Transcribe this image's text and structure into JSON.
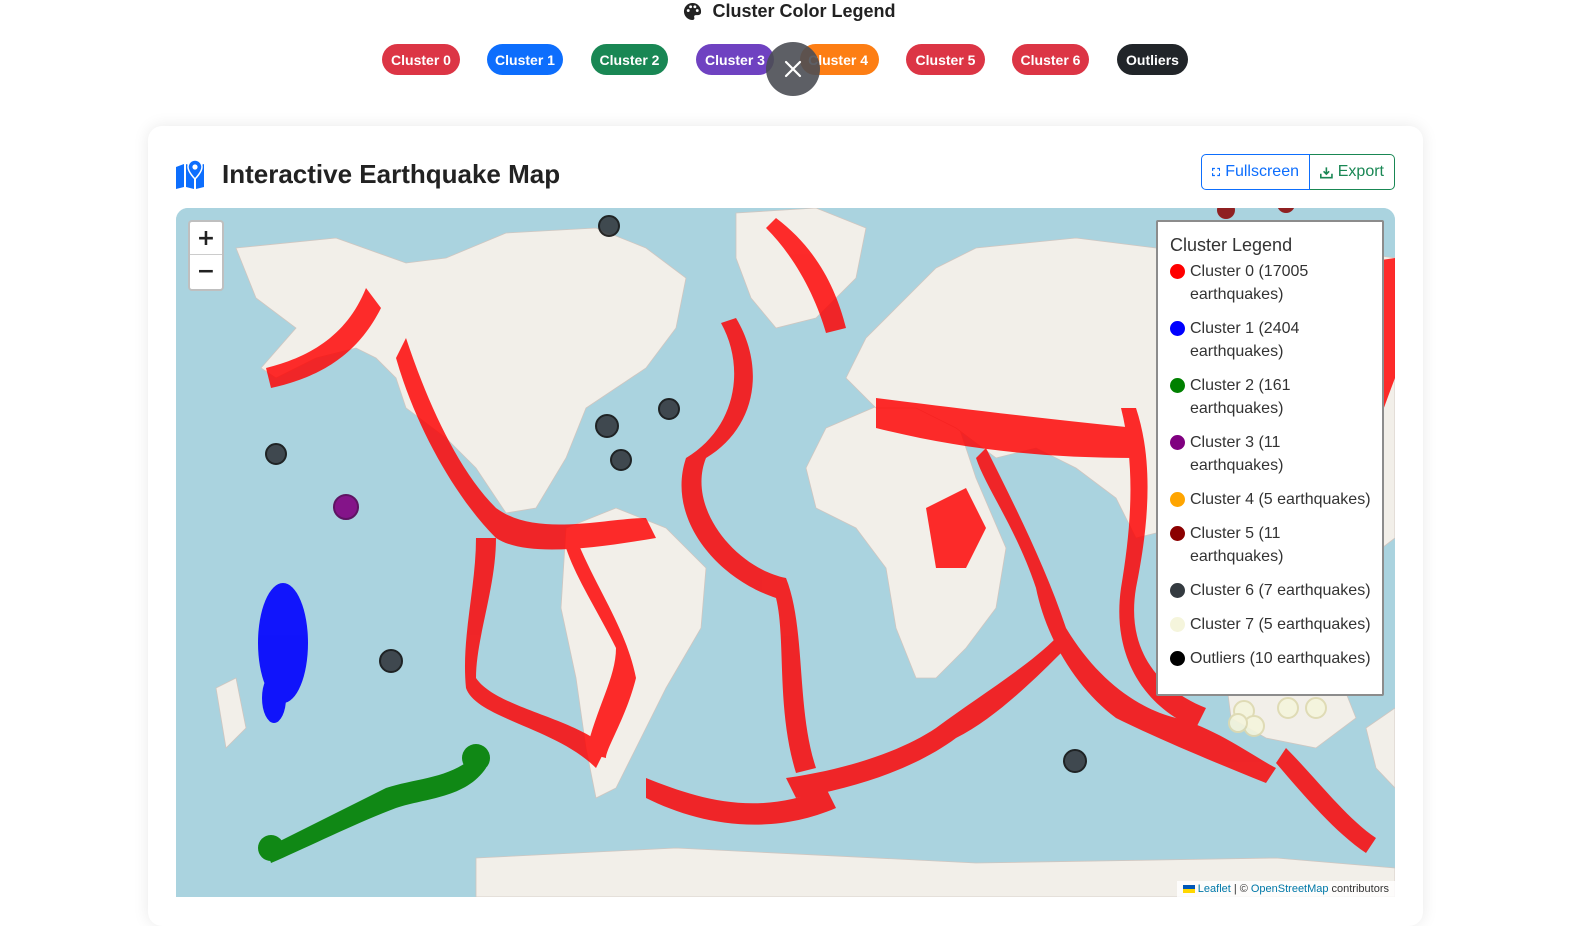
{
  "header": {
    "title": "Cluster Color Legend",
    "pills": [
      {
        "label": "Cluster 0",
        "color": "#dc3545"
      },
      {
        "label": "Cluster 1",
        "color": "#0d6efd"
      },
      {
        "label": "Cluster 2",
        "color": "#198754"
      },
      {
        "label": "Cluster 3",
        "color": "#6f42c1"
      },
      {
        "label": "Cluster 4",
        "color": "#fd7e14"
      },
      {
        "label": "Cluster 5",
        "color": "#dc3545"
      },
      {
        "label": "Cluster 6",
        "color": "#dc3545"
      },
      {
        "label": "Outliers",
        "color": "#212529"
      }
    ]
  },
  "card": {
    "title": "Interactive Earthquake Map",
    "buttons": {
      "fullscreen": "Fullscreen",
      "export": "Export"
    }
  },
  "map": {
    "zoom_in": "+",
    "zoom_out": "−",
    "legend": {
      "title": "Cluster Legend",
      "items": [
        {
          "label": "Cluster 0 (17005 earthquakes)",
          "color": "#ff0000"
        },
        {
          "label": "Cluster 1 (2404 earthquakes)",
          "color": "#0000ff"
        },
        {
          "label": "Cluster 2 (161 earthquakes)",
          "color": "#008000"
        },
        {
          "label": "Cluster 3 (11 earthquakes)",
          "color": "#800080"
        },
        {
          "label": "Cluster 4 (5 earthquakes)",
          "color": "#ffa500"
        },
        {
          "label": "Cluster 5 (11 earthquakes)",
          "color": "#8b0000"
        },
        {
          "label": "Cluster 6 (7 earthquakes)",
          "color": "#343a40"
        },
        {
          "label": "Cluster 7 (5 earthquakes)",
          "color": "#f5f5dc"
        },
        {
          "label": "Outliers (10 earthquakes)",
          "color": "#000000"
        }
      ]
    },
    "attribution": {
      "leaflet": "Leaflet",
      "sep": "| ©",
      "osm": "OpenStreetMap",
      "suffix": "contributors"
    }
  }
}
